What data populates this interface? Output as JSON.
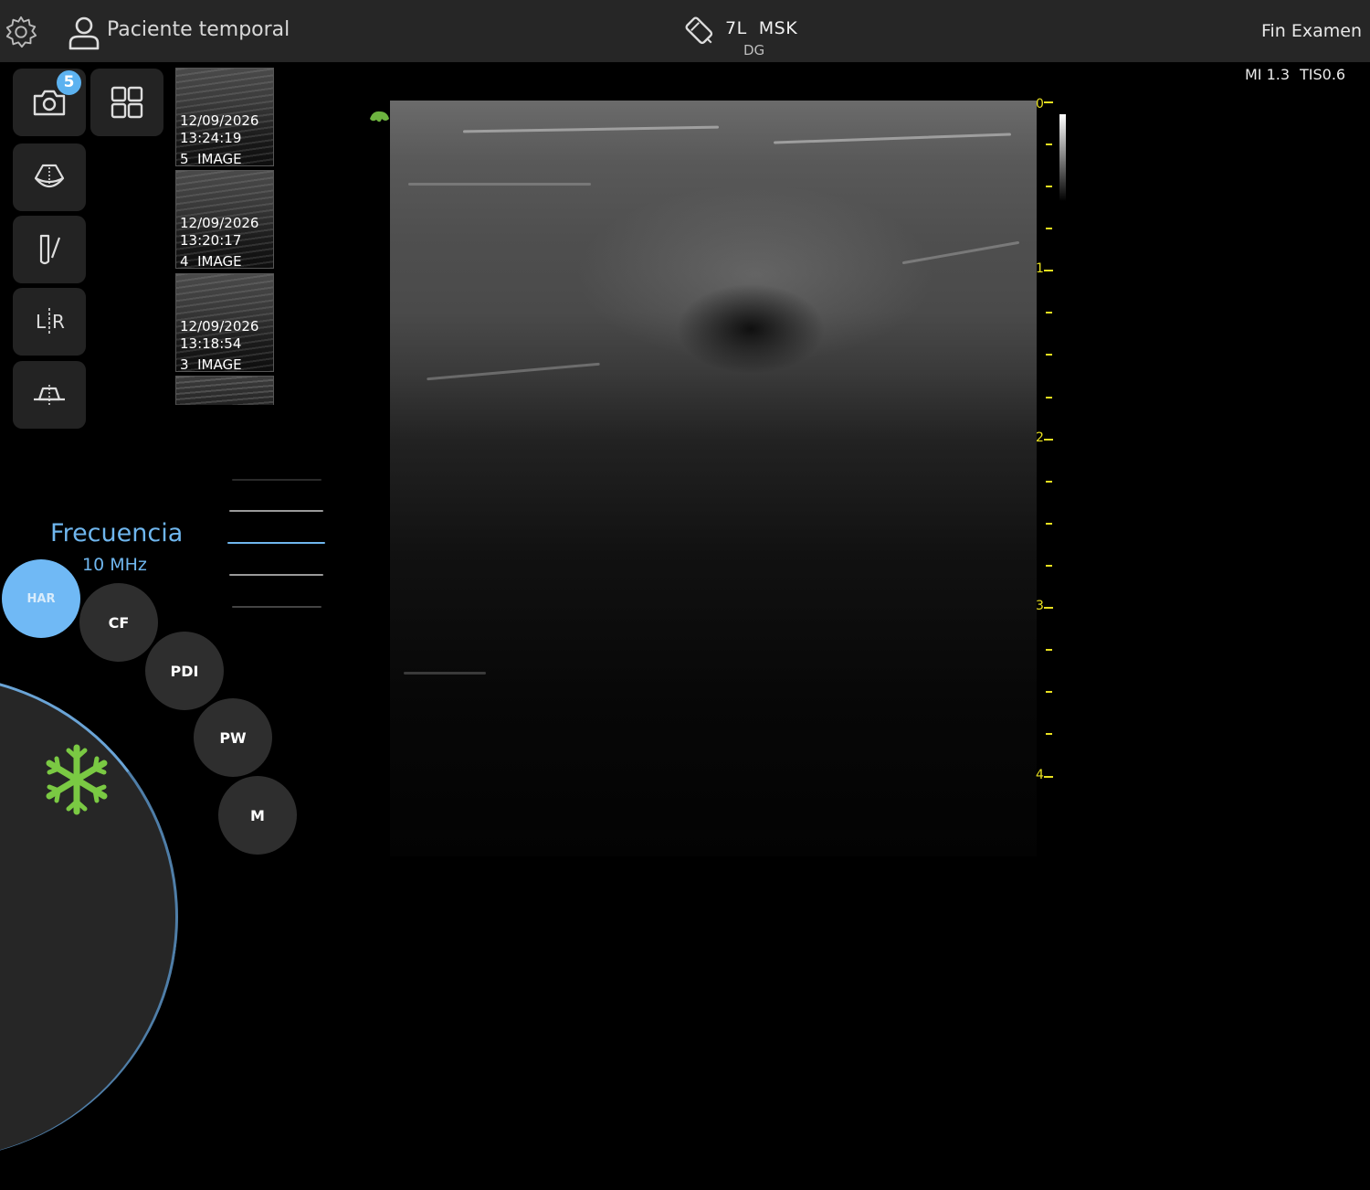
{
  "header": {
    "patient_name": "Paciente temporal",
    "probe": "7L  MSK",
    "probe_sub": "DG",
    "end_exam": "Fin Examen"
  },
  "acoustic": {
    "mi": "MI 1.3",
    "tis": "TIS0.6"
  },
  "toolbar": {
    "capture_count": "5"
  },
  "thumbnails": [
    {
      "date": "12/09/2026",
      "time": "13:24:19",
      "label": "5  IMAGE"
    },
    {
      "date": "12/09/2026",
      "time": "13:20:17",
      "label": "4  IMAGE"
    },
    {
      "date": "12/09/2026",
      "time": "13:18:54",
      "label": "3  IMAGE"
    }
  ],
  "frequency": {
    "label": "Frecuencia",
    "value": "10 MHz"
  },
  "modes": {
    "har": "HAR",
    "cf": "CF",
    "pdi": "PDI",
    "pw": "PW",
    "m": "M",
    "active": "HAR"
  },
  "depth_scale": {
    "labels": [
      "0",
      "1",
      "2",
      "3",
      "4"
    ],
    "color": "#e8e020"
  },
  "colors": {
    "accent": "#6fb6ee",
    "freeze": "#7ac943",
    "topbar": "#262626"
  }
}
